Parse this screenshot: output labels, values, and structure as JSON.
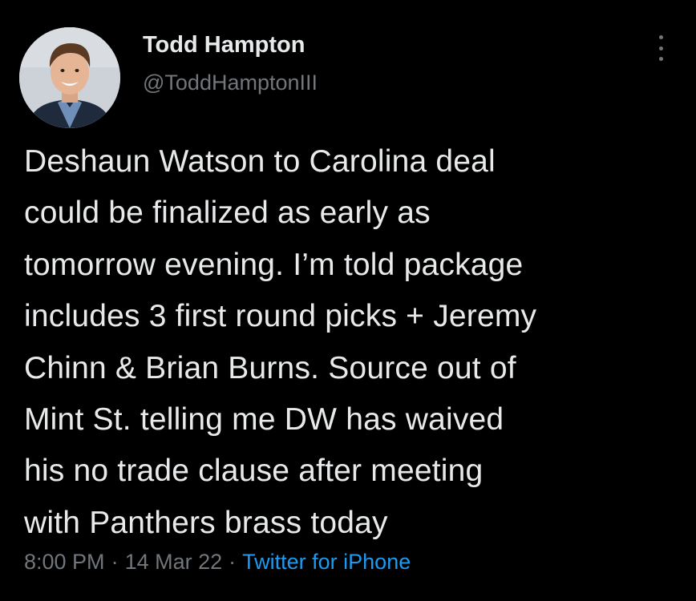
{
  "author": {
    "name": "Todd Hampton",
    "handle": "@ToddHamptonIII"
  },
  "menu_icon": "more-vertical-icon",
  "tweet": {
    "text": "Deshaun Watson to Carolina deal\ncould be finalized as early as\ntomorrow evening. I’m told package\nincludes 3 first round picks + Jeremy\nChinn & Brian Burns. Source out of\nMint St. telling me DW has waived\nhis no trade clause after meeting\nwith Panthers brass today",
    "time": "8:00 PM",
    "date": "14 Mar 22",
    "source": "Twitter for iPhone",
    "separator": "·"
  },
  "colors": {
    "background": "#000000",
    "text": "#e7e9ea",
    "muted": "#71767b",
    "link": "#1d9bf0"
  }
}
